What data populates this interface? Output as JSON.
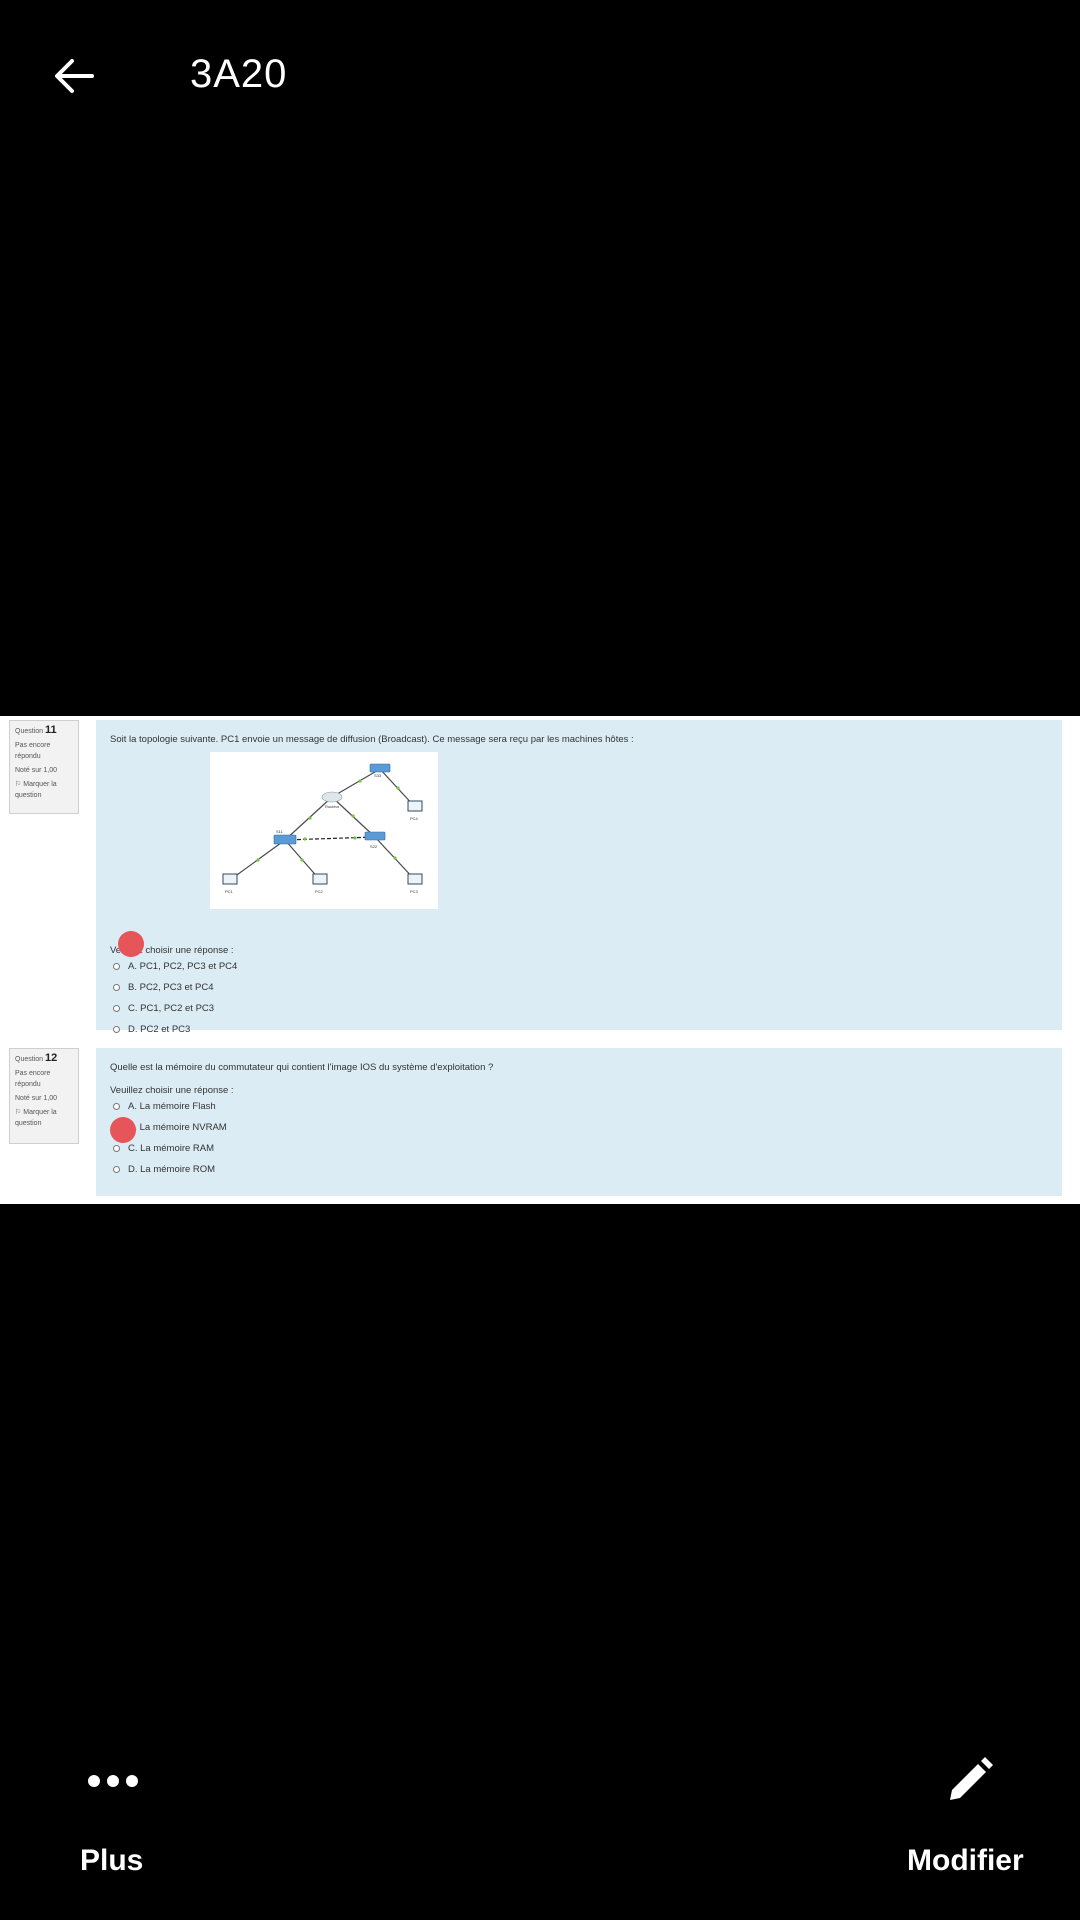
{
  "header": {
    "title": "3A20"
  },
  "questions": [
    {
      "label": "Question",
      "number": "11",
      "status": "Pas encore répondu",
      "grade": "Noté sur 1,00",
      "flag": "Marquer la question",
      "text": "Soit la topologie suivante. PC1 envoie un message de diffusion (Broadcast). Ce message sera reçu par les machines hôtes :",
      "prompt": "Veuillez choisir une réponse :",
      "options": [
        "A. PC1, PC2, PC3 et PC4",
        "B. PC2, PC3 et PC4",
        "C. PC1, PC2 et PC3",
        "D. PC2 et PC3"
      ],
      "diagram_labels": {
        "s33": "S33",
        "router": "Routeur",
        "pc4": "PC4",
        "s11": "S11",
        "s22": "S22",
        "pc1": "PC1",
        "pc2": "PC2",
        "pc3": "PC3"
      }
    },
    {
      "label": "Question",
      "number": "12",
      "status": "Pas encore répondu",
      "grade": "Noté sur 1,00",
      "flag": "Marquer la question",
      "text": "Quelle est la mémoire du commutateur qui contient l'image IOS du système d'exploitation ?",
      "prompt": "Veuillez choisir une réponse :",
      "options": [
        "A. La mémoire Flash",
        "B. La mémoire NVRAM",
        "C. La mémoire RAM",
        "D. La mémoire ROM"
      ]
    }
  ],
  "footer": {
    "more_label": "Plus",
    "edit_label": "Modifier"
  },
  "icons": {
    "back": "arrow-left-icon",
    "more": "more-dots-icon",
    "edit": "pencil-icon"
  },
  "colors": {
    "background": "#000000",
    "question_box": "#dcecf4",
    "touch_marker": "#e5555a",
    "info_box": "#f2f2f2"
  }
}
